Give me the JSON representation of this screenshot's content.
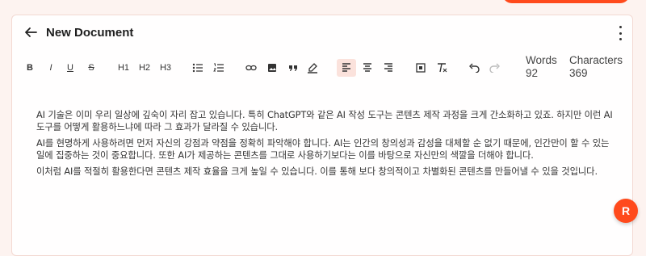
{
  "header": {
    "title": "New Document",
    "back_icon": "arrow-left-icon",
    "menu_icon": "more-vertical-icon"
  },
  "toolbar": {
    "bold": "B",
    "italic": "I",
    "underline": "U",
    "strike": "S",
    "h1": "H1",
    "h2": "H2",
    "h3": "H3",
    "active_item": "align-left"
  },
  "stats": {
    "words_label": "Words",
    "words_value": "92",
    "characters_label": "Characters",
    "characters_value": "369"
  },
  "editor": {
    "paragraphs": [
      "AI 기술은 이미 우리 일상에 깊숙이 자리 잡고 있습니다. 특히 ChatGPT와 같은 AI 작성 도구는 콘텐츠 제작 과정을 크게 간소화하고 있죠. 하지만 이런 AI 도구를 어떻게 활용하느냐에 따라 그 효과가 달라질 수 있습니다.",
      "AI를 현명하게 사용하려면 먼저 자신의 강점과 약점을 정확히 파악해야 합니다. AI는 인간의 창의성과 감성을 대체할 순 없기 때문에, 인간만이 할 수 있는 일에 집중하는 것이 중요합니다. 또한 AI가 제공하는 콘텐츠를 그대로 사용하기보다는 이를 바탕으로 자신만의 색깔을 더해야 합니다.",
      "이처럼 AI를 적절히 활용한다면 콘텐츠 제작 효율을 크게 높일 수 있습니다. 이를 통해 보다 창의적이고 차별화된 콘텐츠를 만들어낼 수 있을 것입니다."
    ]
  },
  "fab": {
    "label": "R"
  },
  "colors": {
    "accent": "#ff4a1c",
    "background": "#fdf3f0",
    "active_bg": "#fbe2dc"
  }
}
